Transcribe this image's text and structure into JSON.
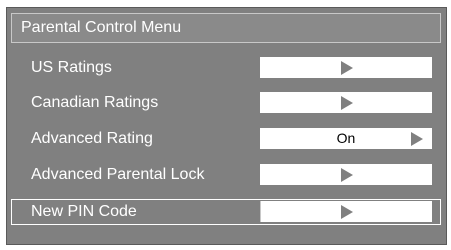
{
  "menu": {
    "title": "Parental Control Menu",
    "items": [
      {
        "label": "US Ratings",
        "value": ""
      },
      {
        "label": "Canadian Ratings",
        "value": ""
      },
      {
        "label": "Advanced Rating",
        "value": "On"
      },
      {
        "label": "Advanced Parental Lock",
        "value": ""
      },
      {
        "label": "New PIN Code",
        "value": ""
      }
    ],
    "selected_item": "New PIN Code",
    "arrow_icon": "right-arrow-icon"
  }
}
